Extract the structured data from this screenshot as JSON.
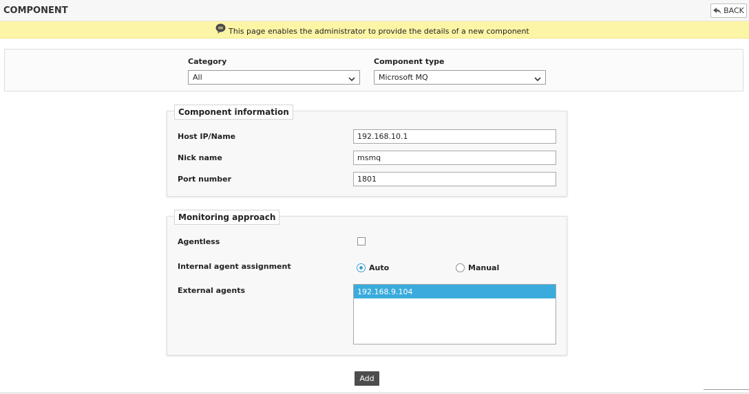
{
  "header": {
    "title": "COMPONENT",
    "back_label": "BACK"
  },
  "banner": {
    "text": "This page enables the administrator to provide the details of a new component",
    "icon": "comment-icon"
  },
  "selectors": {
    "category": {
      "label": "Category",
      "value": "All"
    },
    "component_type": {
      "label": "Component type",
      "value": "Microsoft MQ"
    }
  },
  "component_info": {
    "legend": "Component information",
    "fields": [
      {
        "label": "Host IP/Name",
        "value": "192.168.10.1"
      },
      {
        "label": "Nick name",
        "value": "msmq"
      },
      {
        "label": "Port number",
        "value": "1801"
      }
    ]
  },
  "monitoring": {
    "legend": "Monitoring approach",
    "agentless_label": "Agentless",
    "agentless_checked": false,
    "internal_label": "Internal agent assignment",
    "auto_label": "Auto",
    "manual_label": "Manual",
    "selected_assignment": "Auto",
    "external_label": "External agents",
    "external_agents": [
      "192.168.9.104"
    ]
  },
  "actions": {
    "add_label": "Add"
  },
  "colors": {
    "banner": "#fdf5a6",
    "selection": "#3aabdc",
    "radio_accent": "#3a9ad0",
    "button_dark": "#4d4d4d"
  }
}
